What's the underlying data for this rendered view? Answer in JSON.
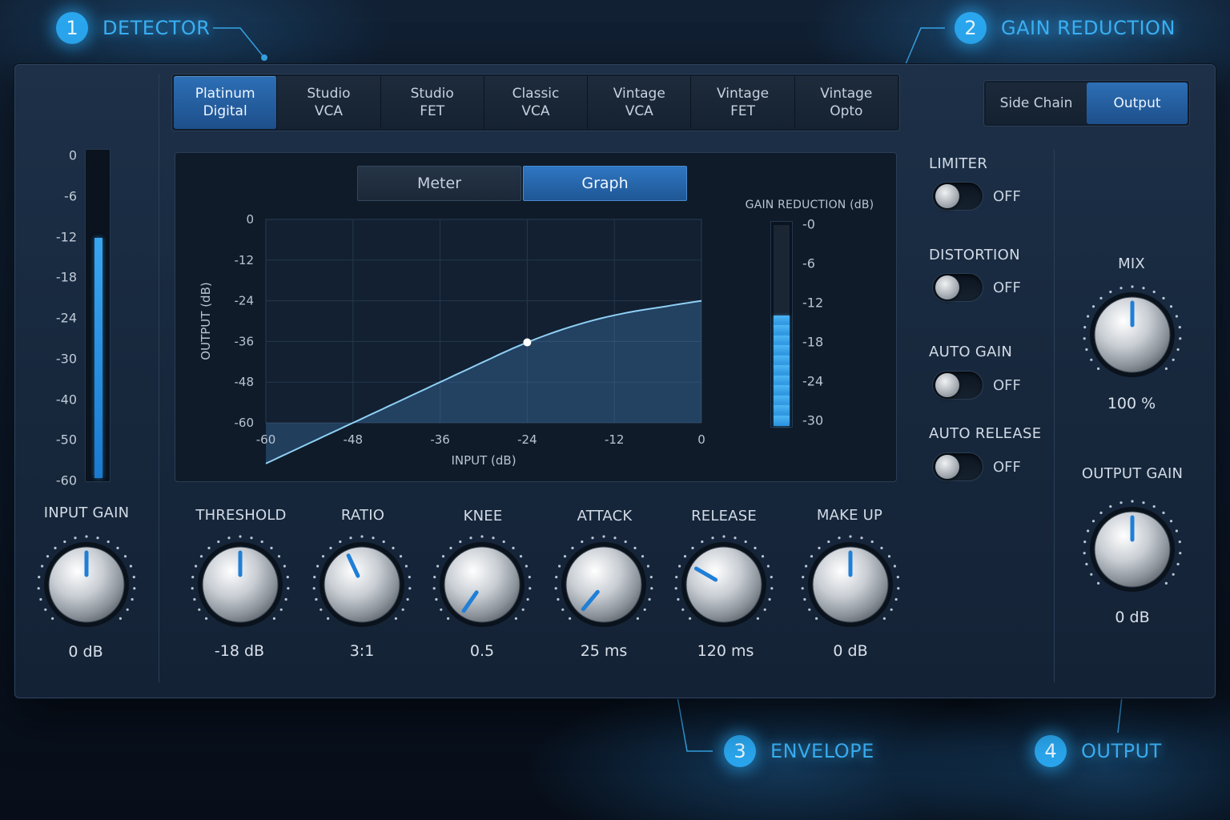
{
  "callouts": [
    {
      "num": "1",
      "label": "DETECTOR"
    },
    {
      "num": "2",
      "label": "GAIN REDUCTION"
    },
    {
      "num": "3",
      "label": "ENVELOPE"
    },
    {
      "num": "4",
      "label": "OUTPUT"
    }
  ],
  "models": [
    {
      "label": "Platinum\nDigital",
      "active": true
    },
    {
      "label": "Studio\nVCA",
      "active": false
    },
    {
      "label": "Studio\nFET",
      "active": false
    },
    {
      "label": "Classic\nVCA",
      "active": false
    },
    {
      "label": "Vintage\nVCA",
      "active": false
    },
    {
      "label": "Vintage\nFET",
      "active": false
    },
    {
      "label": "Vintage\nOpto",
      "active": false
    }
  ],
  "output_tabs": [
    {
      "label": "Side Chain",
      "active": false
    },
    {
      "label": "Output",
      "active": true
    }
  ],
  "input_meter": {
    "scale": [
      "0",
      "-6",
      "-12",
      "-18",
      "-24",
      "-30",
      "-40",
      "-50",
      "-60"
    ],
    "level_db": -12,
    "color": "#39a6f0"
  },
  "view_toggle": {
    "meter": "Meter",
    "graph": "Graph",
    "active": "graph"
  },
  "graph": {
    "ylabel": "OUTPUT (dB)",
    "xlabel": "INPUT (dB)",
    "y_ticks": [
      "0",
      "-12",
      "-24",
      "-36",
      "-48",
      "-60"
    ],
    "x_ticks": [
      "-60",
      "-48",
      "-36",
      "-24",
      "-12",
      "0"
    ],
    "threshold_db": -18,
    "ratio": 3,
    "curve_color": "#8fd0f5"
  },
  "gain_reduction": {
    "title": "GAIN REDUCTION (dB)",
    "scale": [
      "-0",
      "-6",
      "-12",
      "-18",
      "-24",
      "-30"
    ],
    "segments_total": 20,
    "segments_lit": 11
  },
  "switches": [
    {
      "label": "LIMITER",
      "state": "OFF"
    },
    {
      "label": "DISTORTION",
      "state": "OFF"
    },
    {
      "label": "AUTO GAIN",
      "state": "OFF"
    },
    {
      "label": "AUTO RELEASE",
      "state": "OFF"
    }
  ],
  "knobs": {
    "input_gain": {
      "label": "INPUT GAIN",
      "value": "0 dB",
      "angle": 0
    },
    "threshold": {
      "label": "THRESHOLD",
      "value": "-18 dB",
      "angle": 0
    },
    "ratio": {
      "label": "RATIO",
      "value": "3:1",
      "angle": -25
    },
    "knee": {
      "label": "KNEE",
      "value": "0.5",
      "angle": -145
    },
    "attack": {
      "label": "ATTACK",
      "value": "25 ms",
      "angle": -140
    },
    "release": {
      "label": "RELEASE",
      "value": "120 ms",
      "angle": -60
    },
    "make_up": {
      "label": "MAKE UP",
      "value": "0 dB",
      "angle": 0
    },
    "mix": {
      "label": "MIX",
      "value": "100 %",
      "angle": 0
    },
    "output_gain": {
      "label": "OUTPUT GAIN",
      "value": "0 dB",
      "angle": 0
    }
  },
  "colors": {
    "accent": "#2aa6ee",
    "panel": "#1b2d44",
    "indicator": "#1f7fd6"
  }
}
